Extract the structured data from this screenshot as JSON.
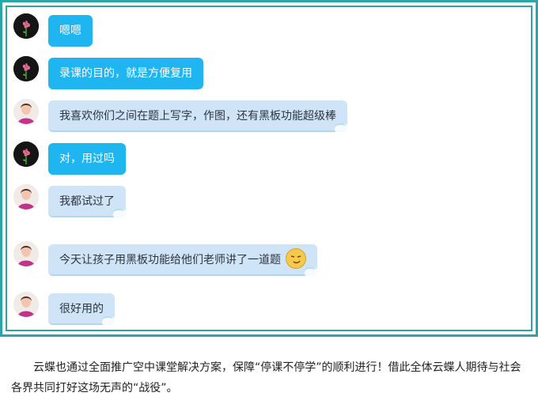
{
  "chat": {
    "messages": [
      {
        "sender": "rose",
        "style": "blue",
        "text": "嗯嗯"
      },
      {
        "sender": "rose",
        "style": "blue",
        "text": "录课的目的，就是方便复用"
      },
      {
        "sender": "woman",
        "style": "light",
        "text": "我喜欢你们之间在题上写字，作图，还有黑板功能超级棒"
      },
      {
        "sender": "rose",
        "style": "blue",
        "text": "对，用过吗"
      },
      {
        "sender": "woman",
        "style": "light",
        "text": "我都试过了"
      },
      {
        "sender": "woman",
        "style": "light",
        "text": "今天让孩子用黑板功能给他们老师讲了一道题",
        "emoji": "smirk-face-icon"
      },
      {
        "sender": "woman",
        "style": "light",
        "text": "很好用的"
      }
    ]
  },
  "article": {
    "paragraph": "云蝶也通过全面推广空中课堂解决方案，保障“停课不停学”的顺利进行！借此全体云蝶人期待与社会各界共同打好这场无声的“战役”。"
  },
  "colors": {
    "frame": "#2fa4a8",
    "bubble_blue": "#1eb5f1",
    "bubble_light": "#cfe5f7"
  }
}
